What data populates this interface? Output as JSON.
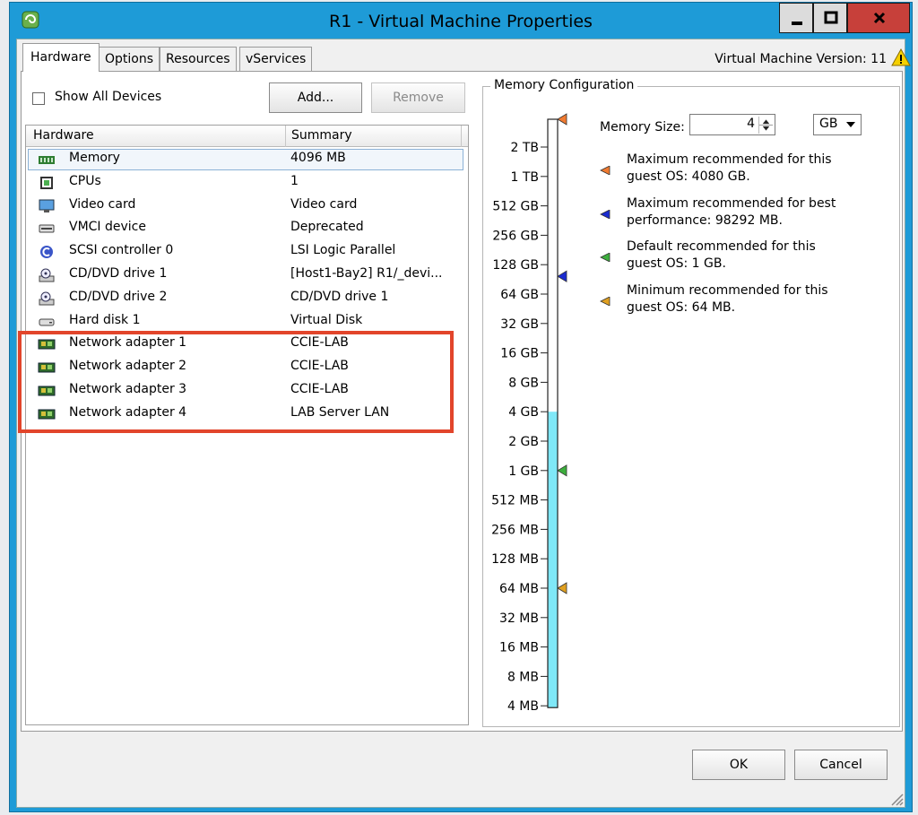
{
  "window": {
    "title": "R1 - Virtual Machine Properties"
  },
  "tabs": [
    "Hardware",
    "Options",
    "Resources",
    "vServices"
  ],
  "vm_version": "Virtual Machine Version: 11",
  "show_all_devices": {
    "label": "Show All Devices",
    "checked": false
  },
  "buttons": {
    "add": "Add...",
    "remove": "Remove",
    "ok": "OK",
    "cancel": "Cancel"
  },
  "table": {
    "columns": [
      "Hardware",
      "Summary"
    ],
    "rows": [
      {
        "icon": "memory-icon",
        "name": "Memory",
        "summary": "4096 MB",
        "selected": true
      },
      {
        "icon": "cpu-icon",
        "name": "CPUs",
        "summary": "1"
      },
      {
        "icon": "monitor-icon",
        "name": "Video card",
        "summary": "Video card"
      },
      {
        "icon": "device-icon",
        "name": "VMCI device",
        "summary": "Deprecated"
      },
      {
        "icon": "scsi-icon",
        "name": "SCSI controller 0",
        "summary": "LSI Logic Parallel"
      },
      {
        "icon": "cd-drive-icon",
        "name": "CD/DVD drive 1",
        "summary": "[Host1-Bay2] R1/_devi..."
      },
      {
        "icon": "cd-drive-icon",
        "name": "CD/DVD drive 2",
        "summary": "CD/DVD drive 1"
      },
      {
        "icon": "hard-disk-icon",
        "name": "Hard disk 1",
        "summary": "Virtual Disk"
      },
      {
        "icon": "network-adapter-icon",
        "name": "Network adapter 1",
        "summary": "CCIE-LAB"
      },
      {
        "icon": "network-adapter-icon",
        "name": "Network adapter 2",
        "summary": "CCIE-LAB"
      },
      {
        "icon": "network-adapter-icon",
        "name": "Network adapter 3",
        "summary": "CCIE-LAB"
      },
      {
        "icon": "network-adapter-icon",
        "name": "Network adapter 4",
        "summary": "LAB Server LAN"
      }
    ]
  },
  "memory_config": {
    "group_title": "Memory Configuration",
    "size_label": "Memory Size:",
    "size_value": "4",
    "unit": "GB",
    "scale_labels": [
      "2 TB",
      "1 TB",
      "512 GB",
      "256 GB",
      "128 GB",
      "64 GB",
      "32 GB",
      "16 GB",
      "8 GB",
      "4 GB",
      "2 GB",
      "1 GB",
      "512 MB",
      "256 MB",
      "128 MB",
      "64 MB",
      "32 MB",
      "16 MB",
      "8 MB",
      "4 MB"
    ],
    "scale_fill_upto": "4 GB",
    "legend": [
      {
        "color": "#f07a30",
        "text": "Maximum recommended for this guest OS: 4080 GB."
      },
      {
        "color": "#1a2bd0",
        "text": "Maximum recommended for best performance: 98292 MB."
      },
      {
        "color": "#3dae3d",
        "text": "Default recommended for this guest OS: 1 GB."
      },
      {
        "color": "#e0a020",
        "text": "Minimum recommended for this guest OS: 64 MB."
      }
    ]
  },
  "colors": {
    "accent_frame": "#1e9bd7",
    "highlight_box": "#e2452b",
    "scale_fill": "#7fe8f8"
  }
}
